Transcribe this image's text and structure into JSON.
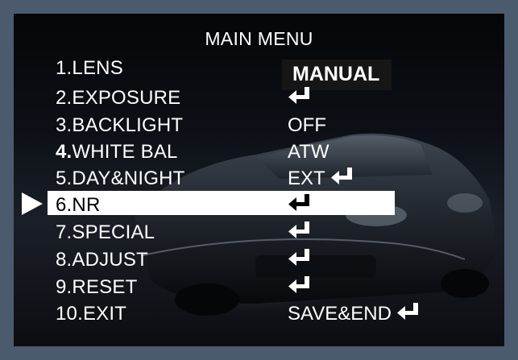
{
  "menu": {
    "title": "MAIN MENU",
    "items": [
      {
        "num": "1.",
        "name": "LENS",
        "value": "MANUAL",
        "value_style": "boxed-bold",
        "enter": false
      },
      {
        "num": "2.",
        "name": "EXPOSURE",
        "value": "",
        "enter": true
      },
      {
        "num": "3.",
        "name": "BACKLIGHT",
        "value": "OFF",
        "enter": false
      },
      {
        "num": "4.",
        "name": "WHITE BAL",
        "value": "ATW",
        "enter": false,
        "num_bold": true
      },
      {
        "num": "5.",
        "name": "DAY&NIGHT",
        "value": "EXT",
        "enter": true
      },
      {
        "num": "6.",
        "name": "NR",
        "value": "",
        "enter": true,
        "selected": true
      },
      {
        "num": "7.",
        "name": "SPECIAL",
        "value": "",
        "enter": true
      },
      {
        "num": "8.",
        "name": "ADJUST",
        "value": "",
        "enter": true
      },
      {
        "num": "9.",
        "name": "RESET",
        "value": "",
        "enter": true
      },
      {
        "num": "10.",
        "name": "EXIT",
        "value": "SAVE&END",
        "enter": true
      }
    ]
  },
  "icons": {
    "enter": "enter-return-icon",
    "pointer": "selection-pointer-icon"
  },
  "colors": {
    "frame": "#4c5a6e",
    "text": "#ffffff",
    "highlight": "#ffffff",
    "highlight_text": "#000000",
    "value_box": "#161616"
  }
}
